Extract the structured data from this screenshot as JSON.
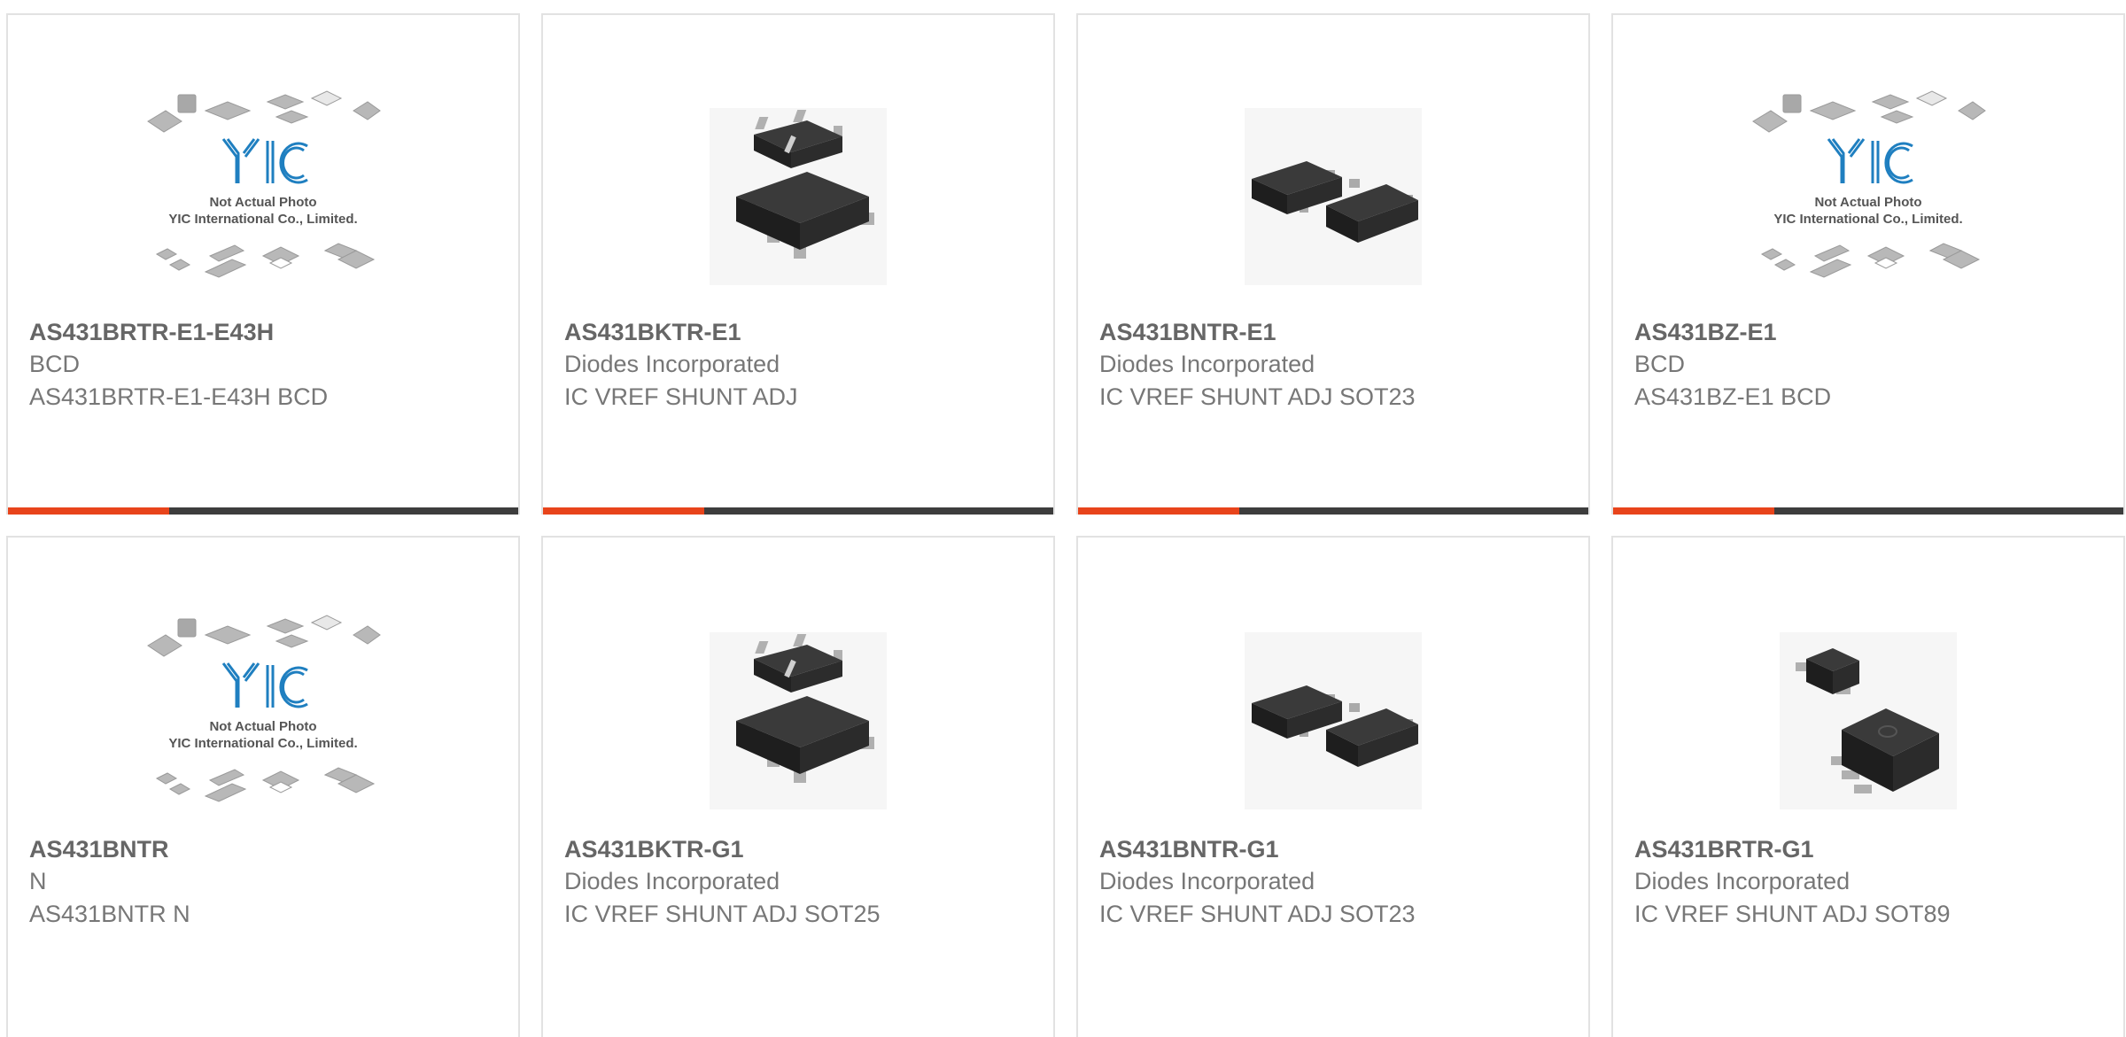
{
  "products": [
    {
      "part": "AS431BRTR-E1-E43H",
      "maker": "BCD",
      "desc": "AS431BRTR-E1-E43H BCD",
      "image": "placeholder-not-actual-photo"
    },
    {
      "part": "AS431BKTR-E1",
      "maker": "Diodes Incorporated",
      "desc": "IC VREF SHUNT ADJ",
      "image": "sot25-chip"
    },
    {
      "part": "AS431BNTR-E1",
      "maker": "Diodes Incorporated",
      "desc": "IC VREF SHUNT ADJ SOT23",
      "image": "sot23-chip"
    },
    {
      "part": "AS431BZ-E1",
      "maker": "BCD",
      "desc": "AS431BZ-E1 BCD",
      "image": "placeholder-not-actual-photo"
    },
    {
      "part": "AS431BNTR",
      "maker": "N",
      "desc": "AS431BNTR N",
      "image": "placeholder-not-actual-photo"
    },
    {
      "part": "AS431BKTR-G1",
      "maker": "Diodes Incorporated",
      "desc": "IC VREF SHUNT ADJ SOT25",
      "image": "sot25-chip"
    },
    {
      "part": "AS431BNTR-G1",
      "maker": "Diodes Incorporated",
      "desc": "IC VREF SHUNT ADJ SOT23",
      "image": "sot23-chip"
    },
    {
      "part": "AS431BRTR-G1",
      "maker": "Diodes Incorporated",
      "desc": "IC VREF SHUNT ADJ SOT89",
      "image": "sot89-chip"
    }
  ],
  "placeholder": {
    "line1": "Not Actual Photo",
    "line2": "YIC International Co., Limited.",
    "logo": "YIC"
  },
  "colors": {
    "accent": "#e8441b",
    "bar": "#3d3d3d",
    "logo": "#1f7fc0"
  }
}
